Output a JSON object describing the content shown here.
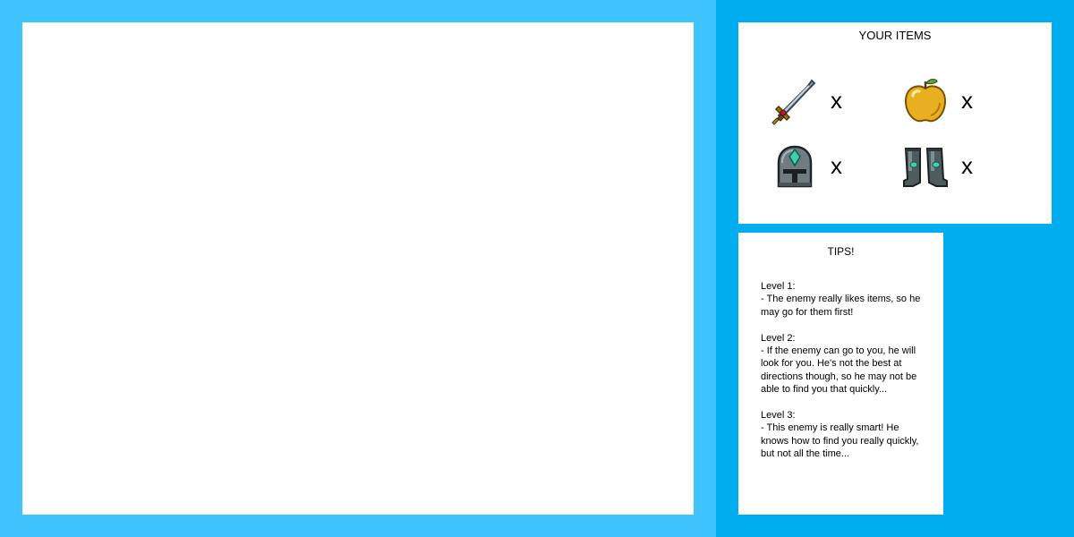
{
  "colors": {
    "left_background": "#40c4ff",
    "right_background": "#00aeef",
    "panel": "#ffffff"
  },
  "items_panel": {
    "title": "YOUR ITEMS",
    "items": [
      {
        "icon": "sword-icon",
        "count": "x"
      },
      {
        "icon": "golden-apple-icon",
        "count": "x"
      },
      {
        "icon": "helmet-icon",
        "count": "x"
      },
      {
        "icon": "boots-icon",
        "count": "x"
      }
    ]
  },
  "tips_panel": {
    "title": "TIPS!",
    "tips": [
      {
        "level": "Level 1:",
        "text": "- The enemy really likes items, so he may go for them first!"
      },
      {
        "level": "Level 2:",
        "text": "- If the enemy can go to you, he will look for you. He's not the best at directions though, so he may not be able to find you that quickly..."
      },
      {
        "level": "Level 3:",
        "text": "- This enemy is really smart! He knows how to find you really quickly, but not all the time..."
      }
    ]
  }
}
